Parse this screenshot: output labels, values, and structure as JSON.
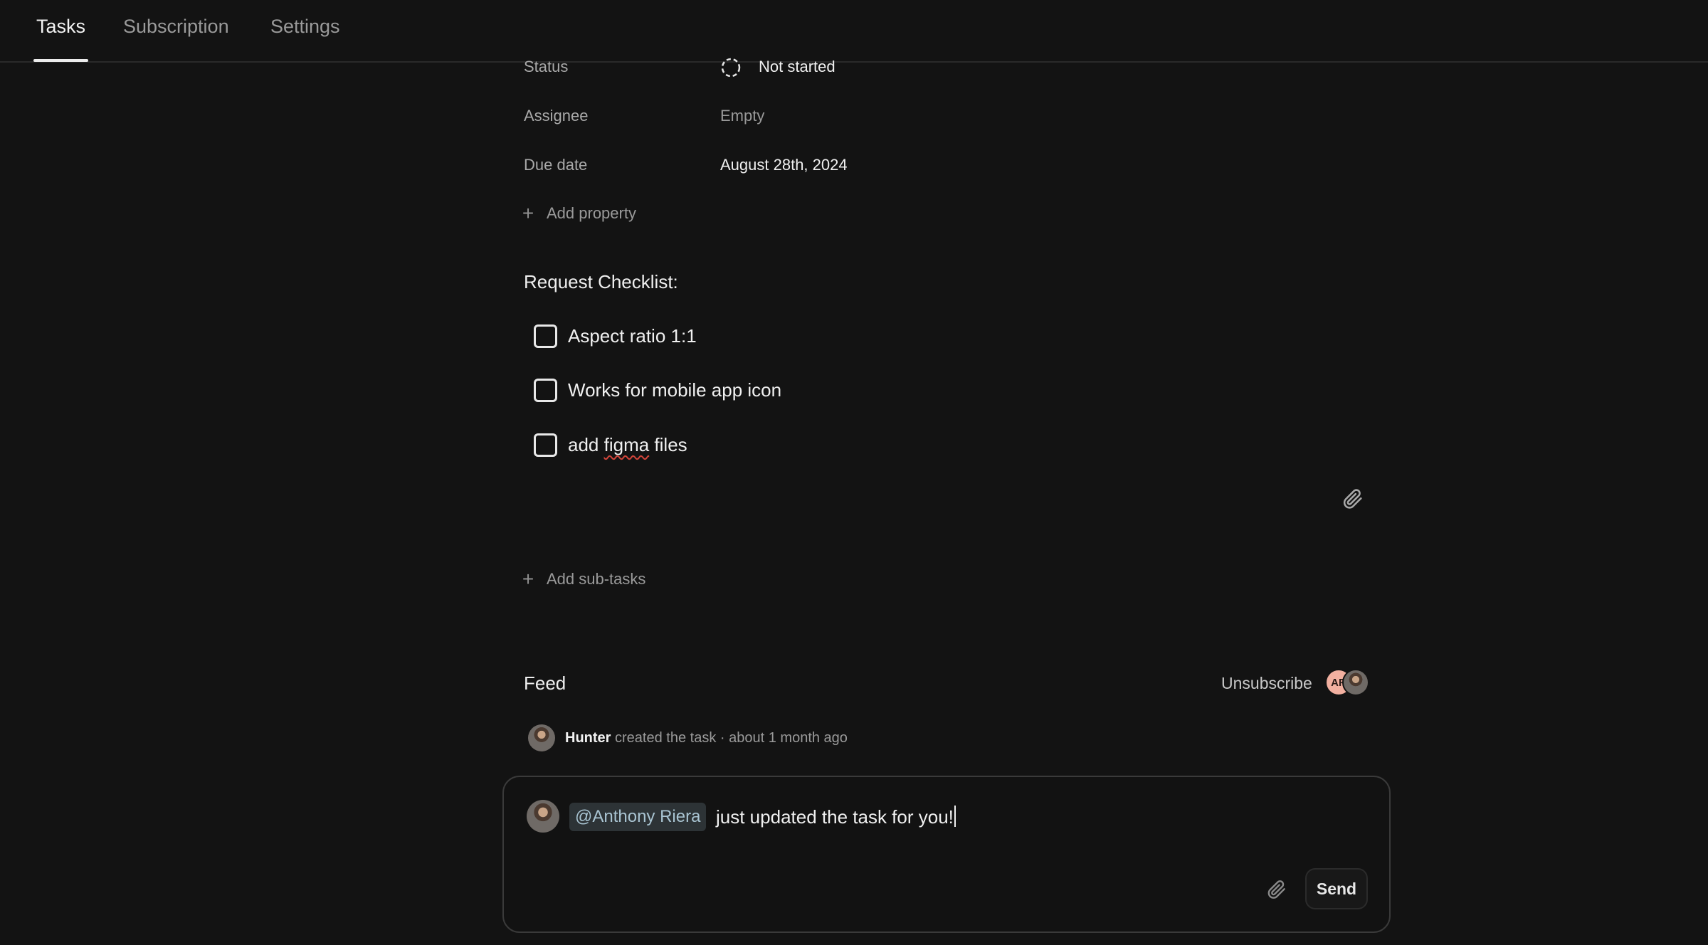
{
  "tabs": [
    {
      "label": "Tasks",
      "active": true
    },
    {
      "label": "Subscription",
      "active": false
    },
    {
      "label": "Settings",
      "active": false
    }
  ],
  "properties": {
    "status": {
      "label": "Status",
      "value": "Not started",
      "icon": "dashed-circle-icon"
    },
    "assignee": {
      "label": "Assignee",
      "value": "Empty"
    },
    "due_date": {
      "label": "Due date",
      "value": "August 28th, 2024"
    }
  },
  "add_property_label": "Add property",
  "checklist": {
    "title": "Request Checklist:",
    "items": [
      {
        "label": "Aspect ratio 1:1",
        "checked": false
      },
      {
        "label": "Works for mobile app icon",
        "checked": false
      },
      {
        "label_prefix": "add ",
        "label_misspelled": "figma",
        "label_suffix": " files",
        "checked": false
      }
    ]
  },
  "add_subtasks_label": "Add sub-tasks",
  "feed": {
    "title": "Feed",
    "unsubscribe_label": "Unsubscribe",
    "subscriber_initials": "AR",
    "entries": [
      {
        "user": "Hunter",
        "action": "created the task",
        "separator": "·",
        "time": "about 1 month ago"
      }
    ]
  },
  "composer": {
    "mention": "@Anthony Riera",
    "text": "just updated the task for you!",
    "send_label": "Send"
  },
  "colors": {
    "background": "#131313",
    "mention_bg": "#2d3336",
    "mention_text": "#a9c4d2",
    "spellcheck": "#d0443a"
  }
}
